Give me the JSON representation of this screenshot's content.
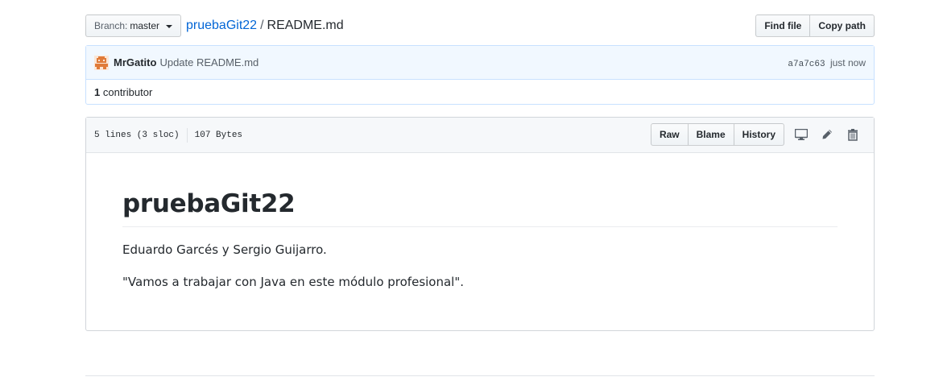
{
  "branch": {
    "label": "Branch:",
    "name": "master"
  },
  "breadcrumb": {
    "repo": "pruebaGit22",
    "separator": "/",
    "file": "README.md"
  },
  "top_actions": {
    "find_file": "Find file",
    "copy_path": "Copy path"
  },
  "commit": {
    "author": "MrGatito",
    "message": "Update README.md",
    "sha": "a7a7c63",
    "time": "just now",
    "contributors_count": "1",
    "contributors_label": "contributor"
  },
  "file": {
    "lines": "5 lines (3 sloc)",
    "size": "107 Bytes",
    "actions": {
      "raw": "Raw",
      "blame": "Blame",
      "history": "History"
    },
    "icons": [
      "desktop-icon",
      "pencil-icon",
      "trash-icon"
    ]
  },
  "readme": {
    "heading": "pruebaGit22",
    "paragraph_1": "Eduardo Garcés y Sergio Guijarro.",
    "paragraph_2": "\"Vamos a trabajar con Java en este módulo profesional\"."
  },
  "colors": {
    "link": "#0366d6",
    "commit_bg": "#f1f8ff",
    "commit_border": "#c8e1ff",
    "avatar": "#e07b39"
  }
}
